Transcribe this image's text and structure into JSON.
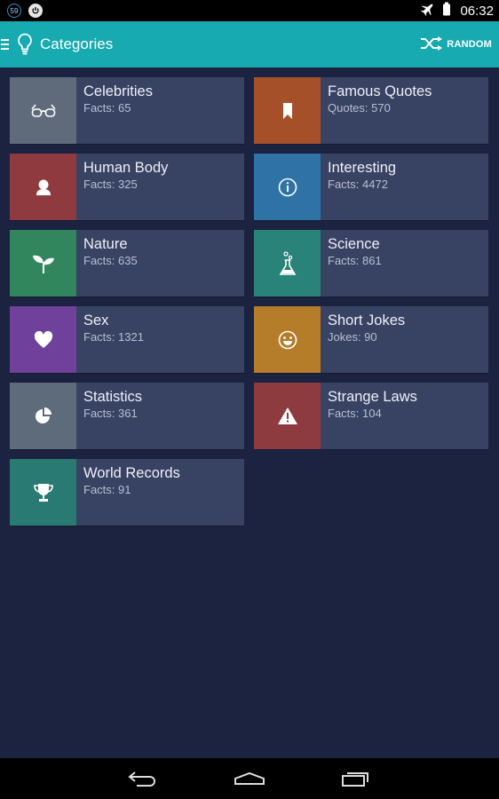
{
  "status_bar": {
    "notification_count": "59",
    "time": "06:32",
    "icons": [
      "notification-badge-icon",
      "power-icon",
      "airplane-mode-icon",
      "battery-icon"
    ]
  },
  "toolbar": {
    "title": "Categories",
    "random_label": "RANDOM",
    "color": "#17aab0"
  },
  "categories": [
    {
      "name": "Celebrities",
      "count": "Facts: 65",
      "color": "#5f6b7b",
      "icon": "glasses-icon"
    },
    {
      "name": "Famous Quotes",
      "count": "Quotes: 570",
      "color": "#a6502a",
      "icon": "bookmark-icon"
    },
    {
      "name": "Human Body",
      "count": "Facts: 325",
      "color": "#8f3a3e",
      "icon": "person-icon"
    },
    {
      "name": "Interesting",
      "count": "Facts: 4472",
      "color": "#2e72a6",
      "icon": "info-icon"
    },
    {
      "name": "Nature",
      "count": "Facts: 635",
      "color": "#31865e",
      "icon": "sprout-icon"
    },
    {
      "name": "Science",
      "count": "Facts: 861",
      "color": "#2a8378",
      "icon": "flask-icon"
    },
    {
      "name": "Sex",
      "count": "Facts: 1321",
      "color": "#70419a",
      "icon": "heart-icon"
    },
    {
      "name": "Short Jokes",
      "count": "Jokes: 90",
      "color": "#b57c2a",
      "icon": "smiley-icon"
    },
    {
      "name": "Statistics",
      "count": "Facts: 361",
      "color": "#5e6b7a",
      "icon": "pie-chart-icon"
    },
    {
      "name": "Strange Laws",
      "count": "Facts: 104",
      "color": "#8e3b40",
      "icon": "warning-icon"
    },
    {
      "name": "World Records",
      "count": "Facts: 91",
      "color": "#287a72",
      "icon": "trophy-icon"
    }
  ],
  "colors": {
    "background": "#1b2340",
    "tile": "#384263"
  }
}
